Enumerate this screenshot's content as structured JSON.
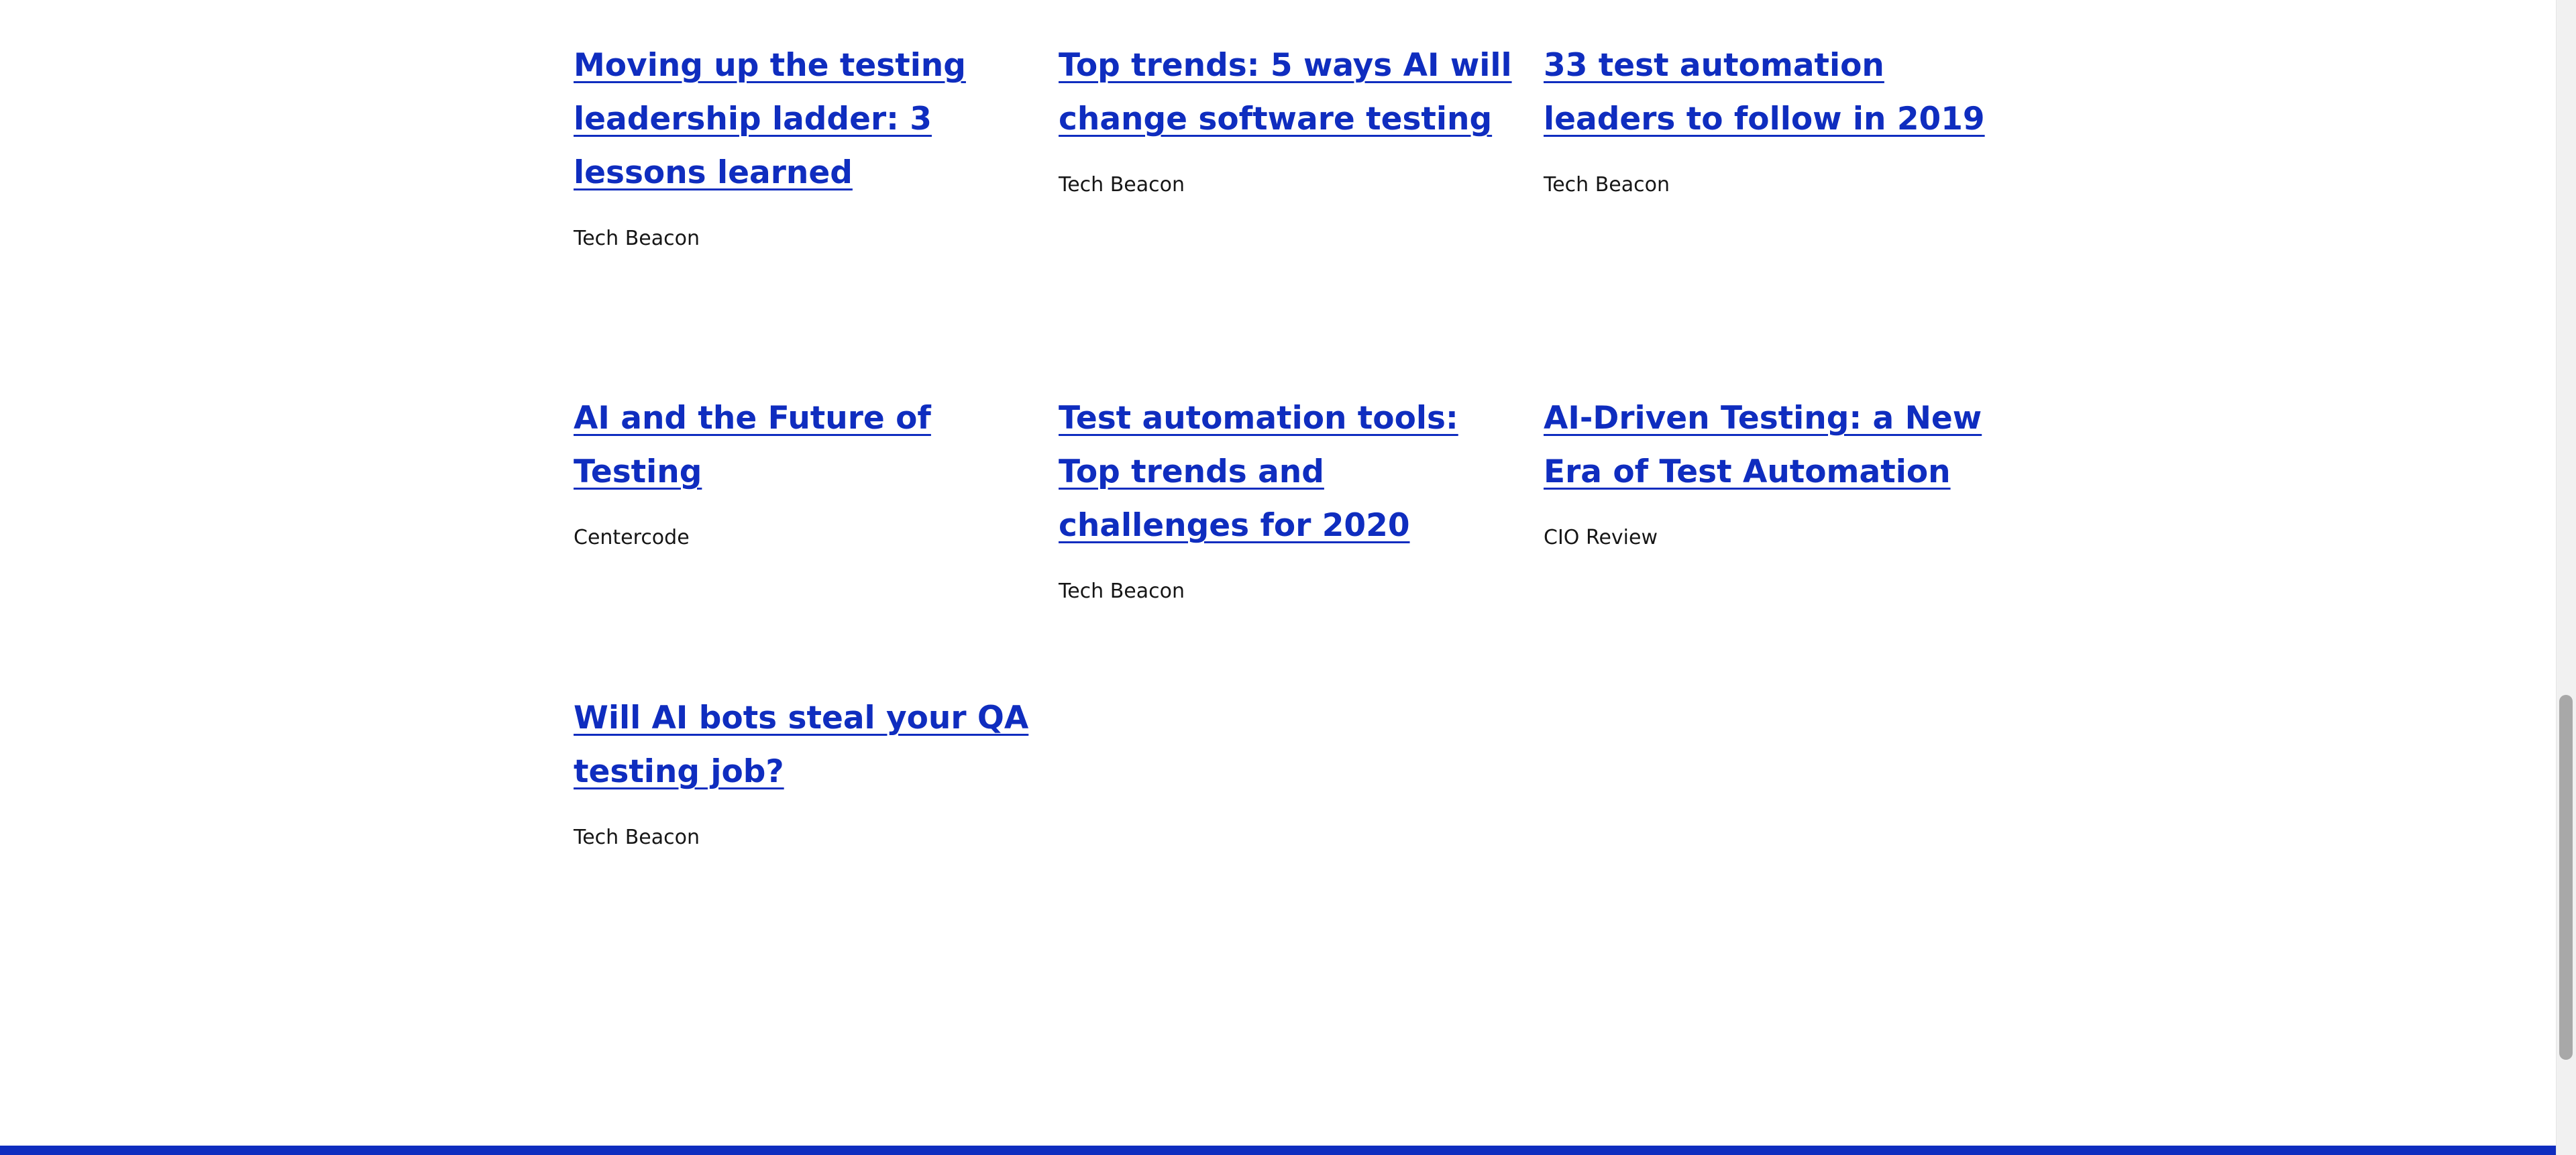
{
  "articles": [
    {
      "title": "Moving up the testing leadership ladder: 3 lessons learned",
      "source": "Tech Beacon"
    },
    {
      "title": "Top trends: 5 ways AI will change software testing",
      "source": "Tech Beacon"
    },
    {
      "title": "33 test automation leaders to follow in 2019",
      "source": "Tech Beacon"
    },
    {
      "title": "AI and the Future of Testing",
      "source": "Centercode"
    },
    {
      "title": "Test automation tools: Top trends and challenges for 2020",
      "source": "Tech Beacon"
    },
    {
      "title": "AI-Driven Testing: a New Era of Test Automation",
      "source": "CIO Review"
    },
    {
      "title": "Will AI bots steal your QA testing job?",
      "source": "Tech Beacon"
    }
  ],
  "colors": {
    "link": "#0f2dbf",
    "text": "#161616",
    "footer_bar": "#0f2dbf",
    "background": "#ffffff"
  }
}
